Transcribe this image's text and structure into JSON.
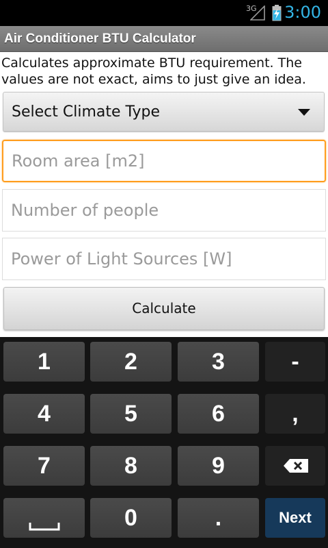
{
  "status_bar": {
    "network": "3G",
    "time": "3:00",
    "time_color": "#33b5e5"
  },
  "app": {
    "title": "Air Conditioner BTU Calculator"
  },
  "content": {
    "description": "Calculates approximate BTU requirement. The values are not exact, aims to just give an idea.",
    "climate_select": {
      "selected": "Select Climate Type"
    },
    "room_area": {
      "placeholder": "Room area [m2]",
      "value": ""
    },
    "people": {
      "placeholder": "Number of people",
      "value": ""
    },
    "light_power": {
      "placeholder": "Power of Light Sources [W]",
      "value": ""
    },
    "calculate_label": "Calculate",
    "focus_color": "#ff9d1e"
  },
  "keyboard": {
    "keys": {
      "k1": "1",
      "k2": "2",
      "k3": "3",
      "dash": "-",
      "k4": "4",
      "k5": "5",
      "k6": "6",
      "comma": ",",
      "k7": "7",
      "k8": "8",
      "k9": "9",
      "k0": "0",
      "dot": ".",
      "next": "Next"
    },
    "icons": {
      "backspace": "backspace-icon",
      "space": "space-bar-icon"
    }
  }
}
